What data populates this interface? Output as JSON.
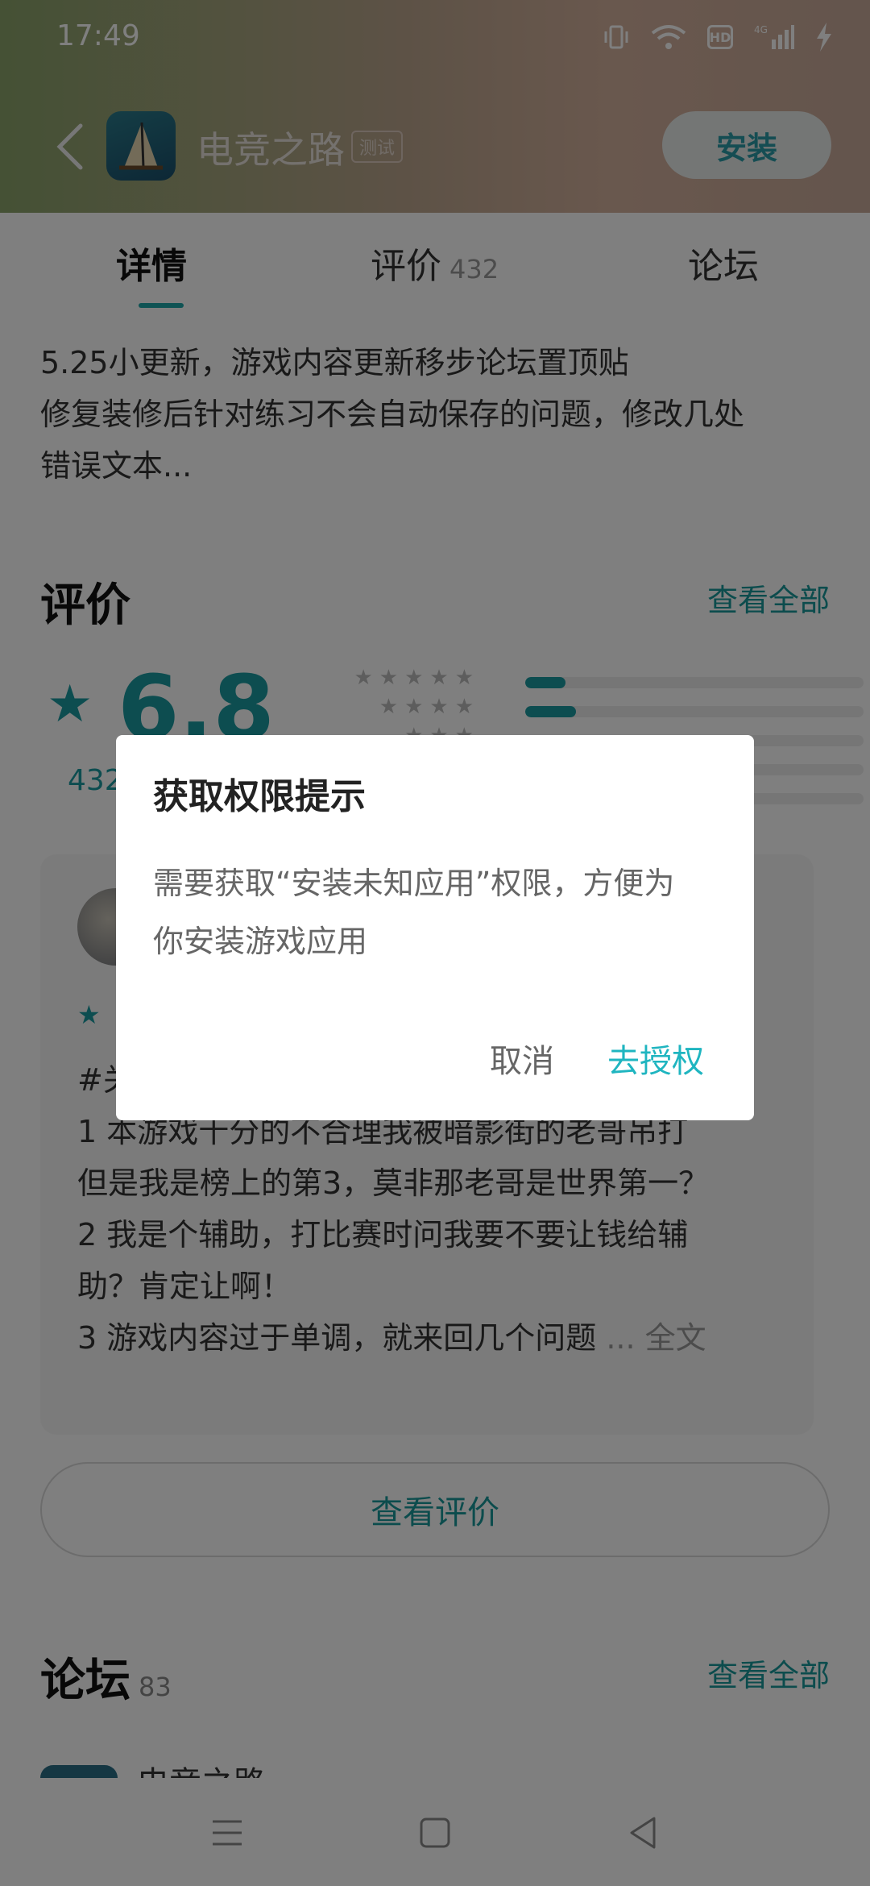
{
  "status_bar": {
    "time": "17:49",
    "icons": [
      "vibrate-icon",
      "wifi-icon",
      "hd-icon",
      "signal-4g-icon",
      "charging-icon"
    ],
    "hd_label": "HD"
  },
  "app_bar": {
    "app_name": "电竞之路",
    "test_tag": "测试",
    "install_label": "安装"
  },
  "tabs": [
    {
      "label": "详情",
      "active": true
    },
    {
      "label": "评价",
      "count": "432"
    },
    {
      "label": "论坛"
    }
  ],
  "update_notes": {
    "line1": "5.25小更新，游戏内容更新移步论坛置顶贴",
    "line2": "修复装修后针对练习不会自动保存的问题，修改几处",
    "line3": "错误文本..."
  },
  "reviews": {
    "title": "评价",
    "see_all": "查看全部",
    "score": "6.8",
    "count_text": "432",
    "distribution": [
      0.12,
      0.15,
      0.18,
      0.06,
      0.04
    ],
    "review_text": {
      "line1": "#关",
      "line2": "1 本游戏十分的不合理我被暗影街的老哥吊打",
      "line3": "但是我是榜上的第3，莫非那老哥是世界第一？",
      "line4": "2 我是个辅助，打比赛时问我要不要让钱给辅",
      "line5": "助？肯定让啊！",
      "line6": "3 游戏内容过于单调，就来回几个问题",
      "more": " ... 全文"
    },
    "view_button": "查看评价"
  },
  "forum": {
    "title": "论坛",
    "count": "83",
    "see_all": "查看全部",
    "first_item_title": "电竞之路"
  },
  "dialog": {
    "title": "获取权限提示",
    "message_line1": "需要获取“安装未知应用”权限，方便为",
    "message_line2": "你安装游戏应用",
    "cancel": "取消",
    "confirm": "去授权"
  },
  "colors": {
    "accent": "#1fb5c0",
    "teal": "#1a9aa0"
  }
}
